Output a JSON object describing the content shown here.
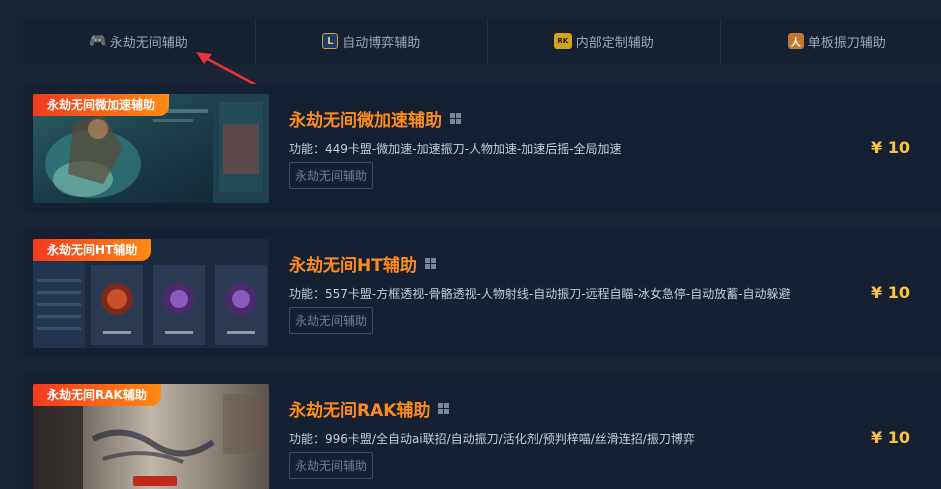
{
  "tabs": [
    {
      "label": "永劫无间辅助",
      "icon": "gamepad-icon",
      "glyph": "🎮"
    },
    {
      "label": "自动博弈辅助",
      "icon": "lol-icon",
      "glyph": "L"
    },
    {
      "label": "内部定制辅助",
      "icon": "rk-icon",
      "glyph": "RK"
    },
    {
      "label": "单板振刀辅助",
      "icon": "character-icon",
      "glyph": "人"
    }
  ],
  "products": [
    {
      "badge": "永劫无间微加速辅助",
      "title": "永劫无间微加速辅助",
      "desc": "功能：449卡盟-微加速-加速振刀-人物加速-加速后摇-全局加速",
      "tag": "永劫无间辅助",
      "price": "¥ 10"
    },
    {
      "badge": "永劫无间HT辅助",
      "title": "永劫无间HT辅助",
      "desc": "功能：557卡盟-方框透视-骨骼透视-人物射线-自动振刀-远程自瞄-冰女急停-自动放蓄-自动躲避",
      "tag": "永劫无间辅助",
      "price": "¥ 10"
    },
    {
      "badge": "永劫无间RAK辅助",
      "title": "永劫无间RAK辅助",
      "desc": "功能：996卡盟/全自动ai联招/自动振刀/活化剂/预判梓喵/丝滑连招/振刀博弈",
      "tag": "永劫无间辅助",
      "price": "¥ 10"
    }
  ],
  "colors": {
    "accent": "#ff8c1a",
    "price": "#ffc23d",
    "badge_start": "#f23a1e",
    "badge_end": "#ff8a14"
  }
}
